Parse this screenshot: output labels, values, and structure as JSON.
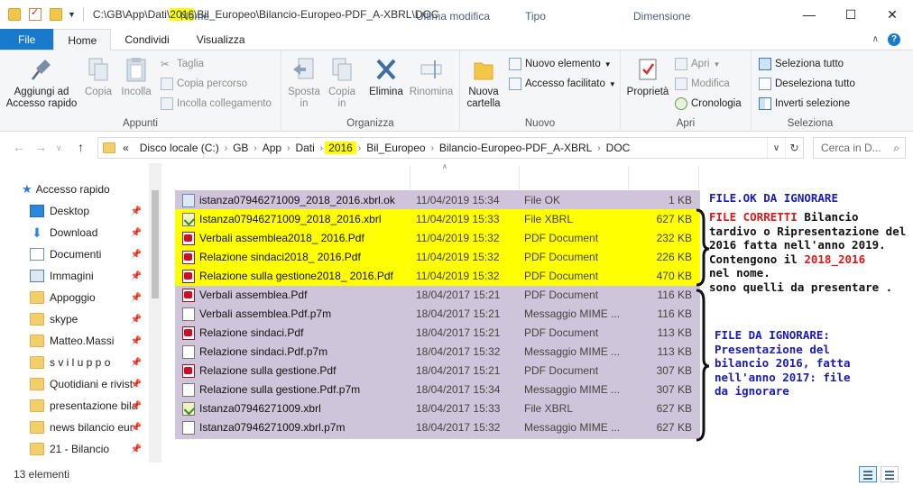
{
  "window": {
    "path_prefix": "C:\\GB\\App\\Dati\\",
    "path_highlight": "2016",
    "path_suffix": "\\Bil_Europeo\\Bilancio-Europeo-PDF_A-XBRL\\DOC",
    "min_icon": "minimize-icon",
    "max_icon": "maximize-icon",
    "close_icon": "close-icon"
  },
  "tabs": {
    "file": "File",
    "home": "Home",
    "share": "Condividi",
    "view": "Visualizza"
  },
  "ribbon": {
    "appunti": {
      "label": "Appunti",
      "pin_line1": "Aggiungi ad",
      "pin_line2": "Accesso rapido",
      "copy": "Copia",
      "paste": "Incolla",
      "cut": "Taglia",
      "copy_path": "Copia percorso",
      "paste_shortcut": "Incolla collegamento"
    },
    "organizza": {
      "label": "Organizza",
      "move_line1": "Sposta",
      "move_line2": "in",
      "copyto_line1": "Copia",
      "copyto_line2": "in",
      "delete": "Elimina",
      "rename": "Rinomina"
    },
    "nuovo": {
      "label": "Nuovo",
      "newfolder_line1": "Nuova",
      "newfolder_line2": "cartella",
      "new_item": "Nuovo elemento",
      "easy_access": "Accesso facilitato"
    },
    "apri": {
      "label": "Apri",
      "properties": "Proprietà",
      "open": "Apri",
      "edit": "Modifica",
      "history": "Cronologia"
    },
    "seleziona": {
      "label": "Seleziona",
      "select_all": "Seleziona tutto",
      "deselect_all": "Deseleziona tutto",
      "invert": "Inverti selezione"
    }
  },
  "address": {
    "chevron": "«",
    "crumbs": [
      "Disco locale (C:)",
      "GB",
      "App",
      "Dati",
      "2016",
      "Bil_Europeo",
      "Bilancio-Europeo-PDF_A-XBRL",
      "DOC"
    ],
    "search_placeholder": "Cerca in D..."
  },
  "nav": {
    "quick_access": "Accesso rapido",
    "items": [
      {
        "label": "Desktop",
        "icon": "desktop-icon"
      },
      {
        "label": "Download",
        "icon": "download-icon"
      },
      {
        "label": "Documenti",
        "icon": "documents-icon"
      },
      {
        "label": "Immagini",
        "icon": "pictures-icon"
      },
      {
        "label": "Appoggio",
        "icon": "folder-icon"
      },
      {
        "label": "skype",
        "icon": "folder-icon"
      },
      {
        "label": "Matteo.Massi",
        "icon": "folder-icon"
      },
      {
        "label": "s v i l u p p o",
        "icon": "folder-icon"
      },
      {
        "label": "Quotidiani e rivist",
        "icon": "folder-icon"
      },
      {
        "label": "presentazione bila",
        "icon": "folder-icon"
      },
      {
        "label": "news bilancio eur",
        "icon": "folder-icon"
      },
      {
        "label": "21 - Bilancio",
        "icon": "folder-icon"
      }
    ]
  },
  "columns": {
    "name": "Nome",
    "date": "Ultima modifica",
    "type": "Tipo",
    "size": "Dimensione"
  },
  "files": [
    {
      "name": "istanza07946271009_2018_2016.xbrl.ok",
      "date": "11/04/2019 15:34",
      "type": "File OK",
      "size": "1 KB",
      "icon": "ok-file-icon"
    },
    {
      "name": "Istanza07946271009_2018_2016.xbrl",
      "date": "11/04/2019 15:33",
      "type": "File XBRL",
      "size": "627 KB",
      "icon": "xbrl-file-icon"
    },
    {
      "name": "Verbali assemblea2018_   2016.Pdf",
      "date": "11/04/2019 15:32",
      "type": "PDF Document",
      "size": "232 KB",
      "icon": "pdf-file-icon"
    },
    {
      "name": "Relazione sindaci2018_  2016.Pdf",
      "date": "11/04/2019 15:32",
      "type": "PDF Document",
      "size": "226 KB",
      "icon": "pdf-file-icon"
    },
    {
      "name": "Relazione sulla gestione2018_  2016.Pdf",
      "date": "11/04/2019 15:32",
      "type": "PDF Document",
      "size": "470 KB",
      "icon": "pdf-file-icon"
    },
    {
      "name": "Verbali assemblea.Pdf",
      "date": "18/04/2017 15:21",
      "type": "PDF Document",
      "size": "116 KB",
      "icon": "pdf-file-icon"
    },
    {
      "name": "Verbali assemblea.Pdf.p7m",
      "date": "18/04/2017 15:21",
      "type": "Messaggio MIME ...",
      "size": "116 KB",
      "icon": "p7m-file-icon"
    },
    {
      "name": "Relazione sindaci.Pdf",
      "date": "18/04/2017 15:21",
      "type": "PDF Document",
      "size": "113 KB",
      "icon": "pdf-file-icon"
    },
    {
      "name": "Relazione sindaci.Pdf.p7m",
      "date": "18/04/2017 15:32",
      "type": "Messaggio MIME ...",
      "size": "113 KB",
      "icon": "p7m-file-icon"
    },
    {
      "name": "Relazione sulla gestione.Pdf",
      "date": "18/04/2017 15:21",
      "type": "PDF Document",
      "size": "307 KB",
      "icon": "pdf-file-icon"
    },
    {
      "name": "Relazione sulla gestione.Pdf.p7m",
      "date": "18/04/2017 15:34",
      "type": "Messaggio MIME ...",
      "size": "307 KB",
      "icon": "p7m-file-icon"
    },
    {
      "name": "Istanza07946271009.xbrl",
      "date": "18/04/2017 15:33",
      "type": "File XBRL",
      "size": "627 KB",
      "icon": "xbrl-file-icon"
    },
    {
      "name": "Istanza07946271009.xbrl.p7m",
      "date": "18/04/2017 15:32",
      "type": "Messaggio MIME ...",
      "size": "627 KB",
      "icon": "p7m-file-icon"
    }
  ],
  "annotations": {
    "ok_note": "FILE.OK DA IGNORARE",
    "correct_red": "FILE CORRETTI",
    "correct_l1_rest": " Bilancio",
    "correct_l2": "tardivo o Ripresentazione del",
    "correct_l3": "2016 fatta nell'anno 2019.",
    "correct_l4_pre": "Contengono il ",
    "correct_l4_red": "2018_2016",
    "correct_l5": "nel nome.",
    "correct_l6": "sono quelli da presentare .",
    "ignore_l1": "FILE DA IGNORARE:",
    "ignore_l2": "Presentazione del",
    "ignore_l3": "bilancio 2016, fatta",
    "ignore_l4": "nell'anno 2017: file",
    "ignore_l5": "da ignorare"
  },
  "colors": {
    "highlight_yellow": "#ffff00",
    "ignore_purple": "#cfc5da",
    "accent_blue": "#1979ca"
  },
  "status": {
    "count": "13 elementi"
  }
}
